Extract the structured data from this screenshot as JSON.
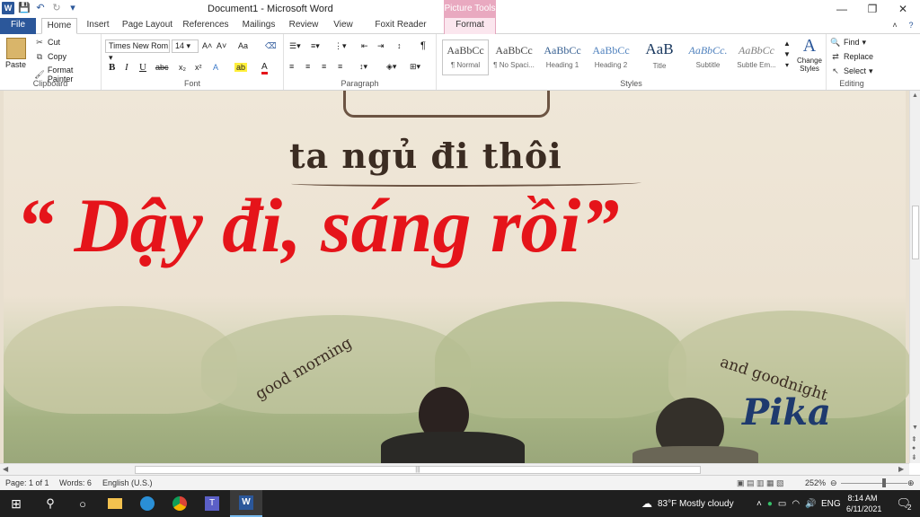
{
  "window": {
    "title": "Document1 - Microsoft Word",
    "picture_tools": "Picture Tools",
    "controls": [
      "—",
      "❐",
      "✕"
    ]
  },
  "quick_access": {
    "save": "💾",
    "undo": "↶",
    "redo": "↻",
    "customize": "▾"
  },
  "tabs": [
    "File",
    "Home",
    "Insert",
    "Page Layout",
    "References",
    "Mailings",
    "Review",
    "View",
    "Foxit Reader PDF",
    "Format"
  ],
  "ribbon": {
    "clipboard": {
      "paste": "Paste",
      "cut": "Cut",
      "copy": "Copy",
      "format_painter": "Format Painter",
      "label": "Clipboard"
    },
    "font": {
      "name": "Times New Rom",
      "size": "14",
      "label": "Font",
      "bold": "B",
      "italic": "I",
      "underline": "U",
      "strike": "abc",
      "sub": "x₂",
      "sup": "x²",
      "grow": "A˄",
      "shrink": "A˅",
      "case": "Aa",
      "highlight": "ab",
      "color": "A"
    },
    "paragraph": {
      "label": "Paragraph",
      "pilcrow": "¶"
    },
    "styles": {
      "label": "Styles",
      "items": [
        {
          "sample": "AaBbCc",
          "name": "¶ Normal"
        },
        {
          "sample": "AaBbCc",
          "name": "¶ No Spaci..."
        },
        {
          "sample": "AaBbCc",
          "name": "Heading 1"
        },
        {
          "sample": "AaBbCc",
          "name": "Heading 2"
        },
        {
          "sample": "AaB",
          "name": "Title"
        },
        {
          "sample": "AaBbCc.",
          "name": "Subtitle"
        },
        {
          "sample": "AaBbCc",
          "name": "Subtle Em..."
        }
      ],
      "change_styles": "Change Styles"
    },
    "editing": {
      "find": "Find",
      "replace": "Replace",
      "select": "Select",
      "label": "Editing"
    }
  },
  "document": {
    "top_text": "ta ngủ đi thôi",
    "headline": "“ Dậy đi, sáng rồi”",
    "good_morning": "good morning",
    "good_night": "and goodnight",
    "signature": "Pika"
  },
  "status": {
    "page": "Page: 1 of 1",
    "words": "Words: 6",
    "language": "English (U.S.)",
    "zoom": "252%"
  },
  "taskbar": {
    "weather": "83°F  Mostly cloudy",
    "lang": "ENG",
    "time": "8:14 AM",
    "date": "6/11/2021",
    "notif": "2"
  },
  "colors": {
    "word_blue": "#2b579a",
    "headline_red": "#e5141a",
    "pika_blue": "#1e3a6e",
    "picture_tools_pink": "#e9a9c0"
  }
}
